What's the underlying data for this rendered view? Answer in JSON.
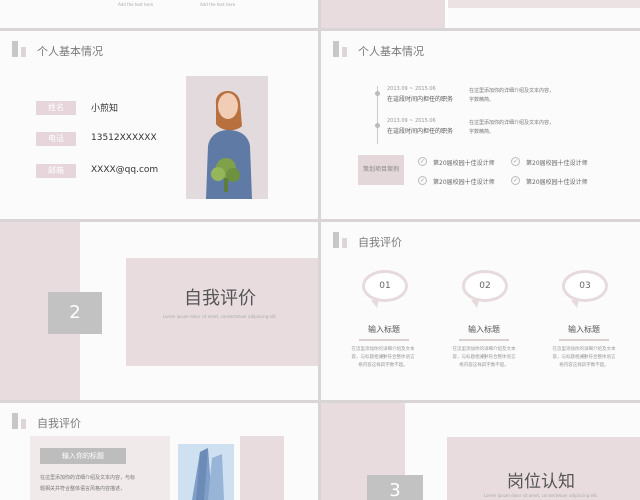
{
  "slide1": {
    "caption_a": "Add the text here",
    "caption_b": "Add the text here"
  },
  "slide3": {
    "title": "个人基本情况",
    "rows": [
      {
        "label": "姓名",
        "value": "小煎知"
      },
      {
        "label": "电话",
        "value": "13512XXXXXX"
      },
      {
        "label": "邮箱",
        "value": "XXXX@qq.com"
      }
    ]
  },
  "slide4": {
    "title": "个人基本情况",
    "timeline": [
      {
        "date": "2013.09 ~ 2015.06",
        "role": "在這段时间内担任的职务",
        "desc_1": "在這里添加你的详细介绍及文本内容，",
        "desc_2": "字数精简。"
      },
      {
        "date": "2013.09 ~ 2015.06",
        "role": "在這段时间内担任的职务",
        "desc_1": "在這里添加你的详细介绍及文本内容，",
        "desc_2": "字数精简。"
      }
    ],
    "project_button": "策划项目案例",
    "awards": [
      "第20届校园十佳设计师",
      "第20届校园十佳设计师",
      "第20届校园十佳设计师",
      "第20届校园十佳设计师"
    ]
  },
  "slide5": {
    "number": "2",
    "title": "自我评价",
    "subtitle": "Lorem ipsum dolor sit amet, consectetuer adipiscing elit."
  },
  "slide6": {
    "title": "自我评价",
    "items": [
      {
        "num": "01",
        "heading": "输入标题",
        "desc_1": "在這里添加你的详细介绍及文本内",
        "desc_2": "容，与标题相关并符合整体语言风",
        "desc_3": "格内容这样，字数不超。"
      },
      {
        "num": "02",
        "heading": "输入标题",
        "desc_1": "在這里添加你的详细介绍及文本内",
        "desc_2": "容，与标题相关并符合整体语言风",
        "desc_3": "格内容这样，字数不超。"
      },
      {
        "num": "03",
        "heading": "输入标题",
        "desc_1": "在這里添加你的详细介绍及文本内",
        "desc_2": "容，与标题相关并符合整体语言风",
        "desc_3": "格内容这样，字数不超。"
      }
    ]
  },
  "slide7": {
    "title": "自我评价",
    "box_title": "输入你的标题",
    "desc_1": "在這里添加你的详细介绍及文本内容，与标",
    "desc_2": "题相关并符合整体语言风格内容描述，"
  },
  "slide8": {
    "number": "3",
    "title": "岗位认知",
    "subtitle": "Lorem ipsum dolor sit amet, consectetuer adipiscing elit."
  }
}
